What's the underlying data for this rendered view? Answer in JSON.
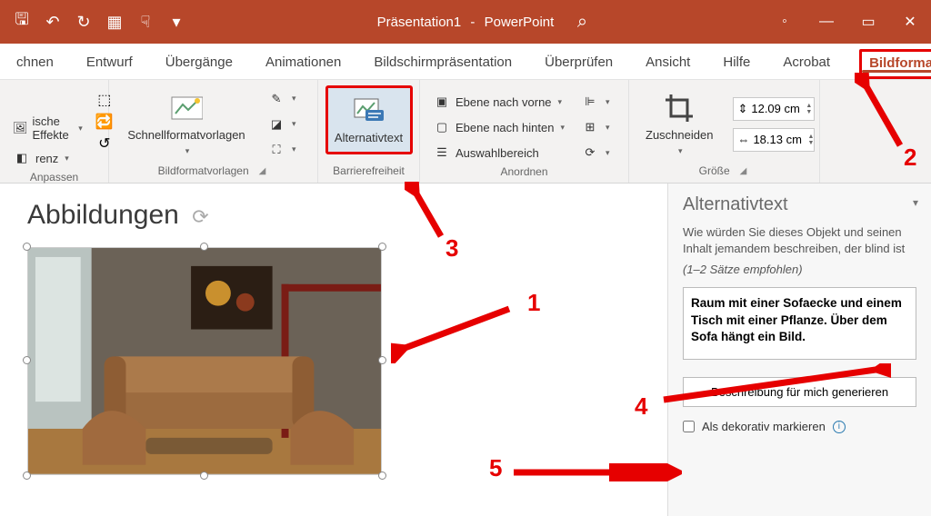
{
  "qat": {
    "save": "🖫",
    "undo": "↶",
    "redo": "↻",
    "start": "▦",
    "touch": "☟",
    "more": "▾"
  },
  "title": {
    "doc": "Präsentation1",
    "app": "PowerPoint"
  },
  "search_icon": "⌕",
  "win": {
    "min": "—",
    "max": "▭",
    "close": "✕"
  },
  "tabs": {
    "t0": "chnen",
    "t1": "Entwurf",
    "t2": "Übergänge",
    "t3": "Animationen",
    "t4": "Bildschirmpräsentation",
    "t5": "Überprüfen",
    "t6": "Ansicht",
    "t7": "Hilfe",
    "t8": "Acrobat",
    "t9": "Bildformat",
    "share": "⇪"
  },
  "ribbon": {
    "g1": {
      "effects": "ische Effekte",
      "transparency": "renz",
      "label": "Anpassen"
    },
    "g2": {
      "quickstyles": "Schnellformatvorlagen",
      "border": "✎",
      "effects": "◪",
      "layout": "⛶",
      "label": "Bildformatvorlagen"
    },
    "g3": {
      "alttext": "Alternativtext",
      "label": "Barrierefreiheit"
    },
    "g4": {
      "forward": "Ebene nach vorne",
      "backward": "Ebene nach hinten",
      "selection": "Auswahlbereich",
      "align": "⊫",
      "group": "⊞",
      "rotate": "⟳",
      "label": "Anordnen"
    },
    "g5": {
      "crop": "Zuschneiden",
      "height": "12.09 cm",
      "width": "18.13 cm",
      "label": "Größe"
    }
  },
  "slide": {
    "title": "Abbildungen"
  },
  "pane": {
    "title": "Alternativtext",
    "desc": "Wie würden Sie dieses Objekt und seinen Inhalt jemandem beschreiben, der blind ist",
    "hint": "(1–2 Sätze empfohlen)",
    "textarea": "Raum mit einer Sofaecke und einem Tisch mit einer Pflanze. Über dem Sofa hängt ein Bild.",
    "generate": "Beschreibung für mich generieren",
    "decorative": "Als dekorativ markieren"
  },
  "annotations": {
    "n1": "1",
    "n2": "2",
    "n3": "3",
    "n4": "4",
    "n5": "5"
  }
}
